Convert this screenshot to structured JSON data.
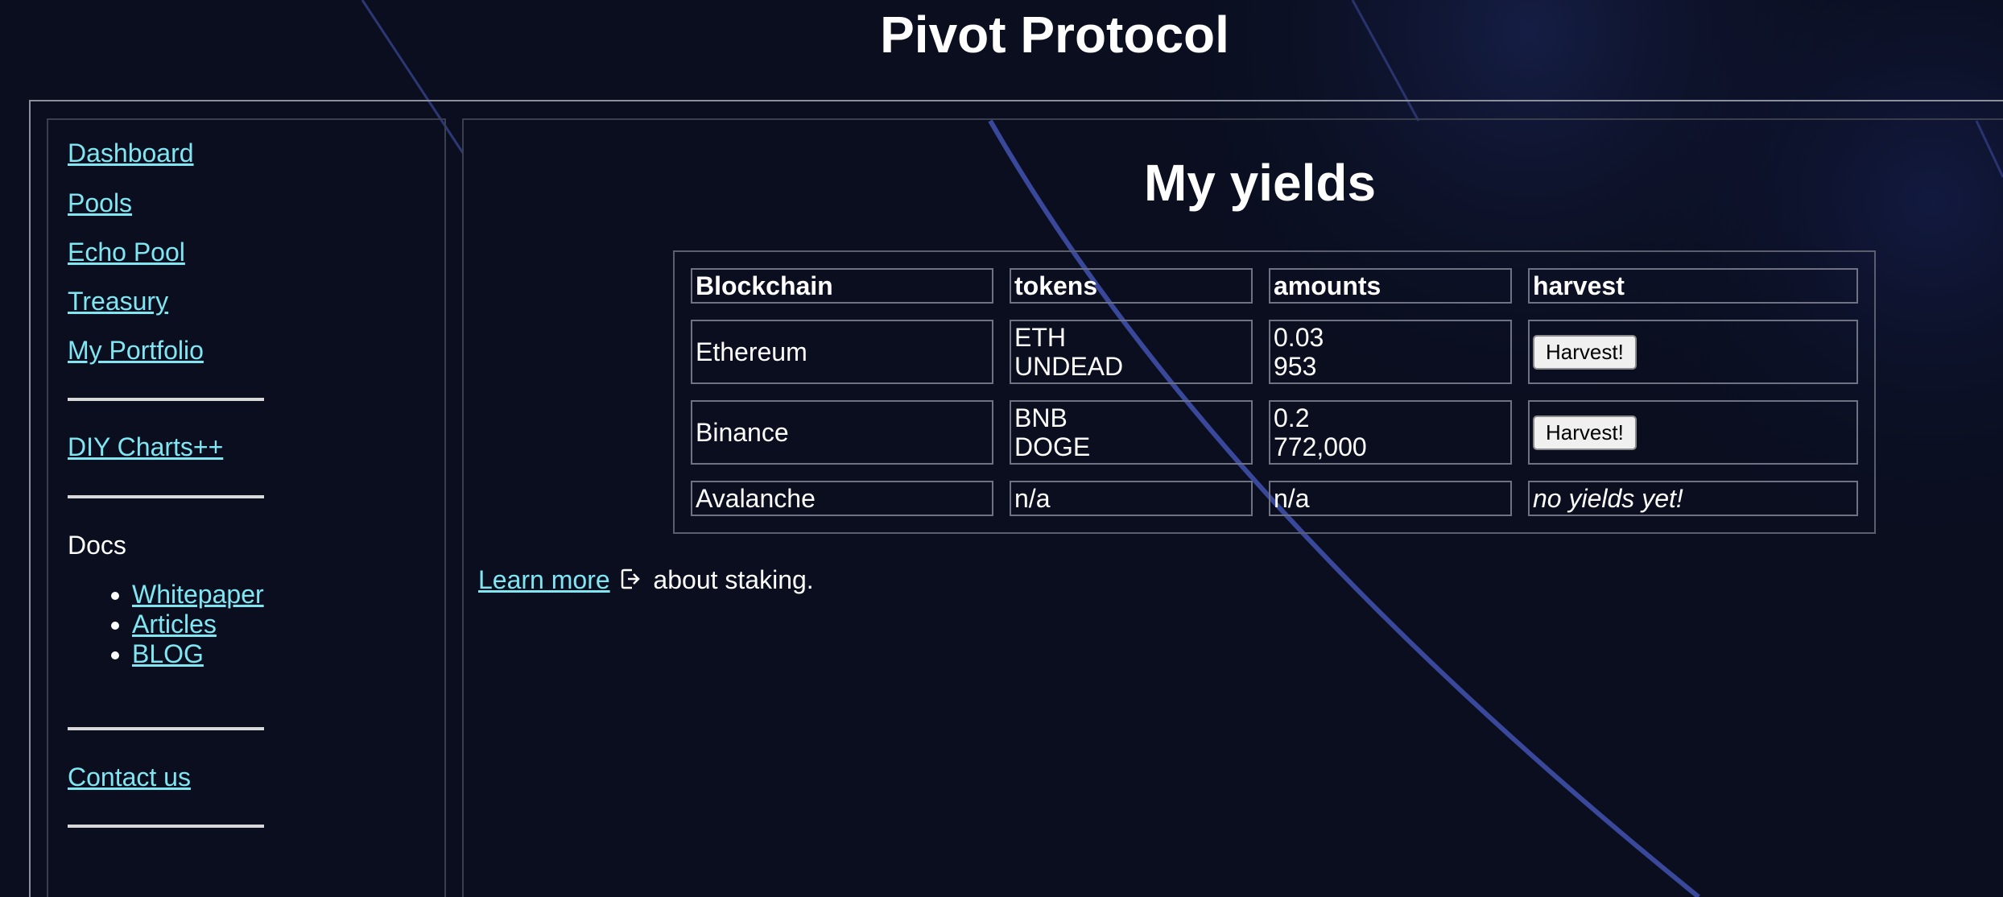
{
  "site": {
    "title": "Pivot Protocol"
  },
  "sidebar": {
    "items": [
      {
        "label": "Dashboard"
      },
      {
        "label": "Pools"
      },
      {
        "label": "Echo Pool"
      },
      {
        "label": "Treasury"
      },
      {
        "label": "My Portfolio"
      }
    ],
    "diy_charts": "DIY Charts++",
    "docs_label": "Docs",
    "docs_links": [
      {
        "label": "Whitepaper"
      },
      {
        "label": "Articles"
      },
      {
        "label": "BLOG"
      }
    ],
    "contact": "Contact us"
  },
  "main": {
    "heading": "My yields",
    "table": {
      "headers": [
        "Blockchain",
        "tokens",
        "amounts",
        "harvest"
      ],
      "rows": [
        {
          "chain": "Ethereum",
          "tokens": [
            "ETH",
            "UNDEAD"
          ],
          "amounts": [
            "0.03",
            "953"
          ],
          "harvest": "Harvest!"
        },
        {
          "chain": "Binance",
          "tokens": [
            "BNB",
            "DOGE"
          ],
          "amounts": [
            "0.2",
            "772,000"
          ],
          "harvest": "Harvest!"
        },
        {
          "chain": "Avalanche",
          "tokens": [
            "n/a"
          ],
          "amounts": [
            "n/a"
          ],
          "harvest": "no yields yet!"
        }
      ]
    },
    "learn_more": {
      "link": "Learn more",
      "suffix": "about staking."
    }
  },
  "icons": {
    "external_link": "external-link-icon"
  },
  "colors": {
    "background": "#0a0e1f",
    "link": "#7fe6f2",
    "text": "#ffffff",
    "accent_line": "#4a5cc4"
  }
}
